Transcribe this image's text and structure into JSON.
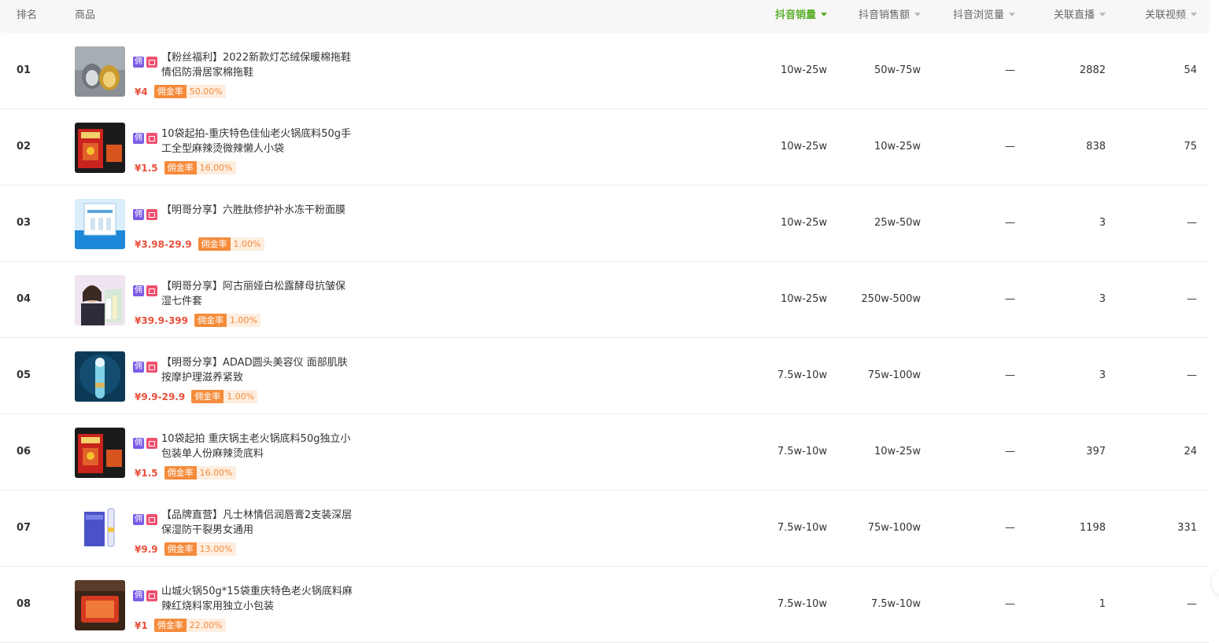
{
  "header": {
    "rank": "排名",
    "product": "商品",
    "sales": "抖音销量",
    "amount": "抖音销售额",
    "views": "抖音浏览量",
    "live": "关联直播",
    "video": "关联视频"
  },
  "labels": {
    "yong": "佣",
    "commission": "佣金率"
  },
  "colors": {
    "accent": "#5bb02c",
    "price": "#e8503a",
    "commission": "#f58b3b"
  },
  "rows": [
    {
      "rank": "01",
      "title": "【粉丝福利】2022新款灯芯绒保暖棉拖鞋情侣防滑居家棉拖鞋",
      "price": "¥4",
      "commission": "50.00%",
      "sales": "10w-25w",
      "amount": "50w-75w",
      "views": "—",
      "live": "2882",
      "video": "54",
      "thumb": "slippers"
    },
    {
      "rank": "02",
      "title": "10袋起拍-重庆特色佳仙老火锅底料50g手工全型麻辣烫微辣懒人小袋",
      "price": "¥1.5",
      "commission": "16.00%",
      "sales": "10w-25w",
      "amount": "10w-25w",
      "views": "—",
      "live": "838",
      "video": "75",
      "thumb": "hotpot"
    },
    {
      "rank": "03",
      "title": "【明哥分享】六胜肽修护补水冻干粉面膜",
      "price": "¥3.98-29.9",
      "commission": "1.00%",
      "sales": "10w-25w",
      "amount": "25w-50w",
      "views": "—",
      "live": "3",
      "video": "—",
      "thumb": "mask"
    },
    {
      "rank": "04",
      "title": "【明哥分享】阿古丽娅白松露酵母抗皱保湿七件套",
      "price": "¥39.9-399",
      "commission": "1.00%",
      "sales": "10w-25w",
      "amount": "250w-500w",
      "views": "—",
      "live": "3",
      "video": "—",
      "thumb": "skincare"
    },
    {
      "rank": "05",
      "title": "【明哥分享】ADAD圆头美容仪 面部肌肤按摩护理滋养紧致",
      "price": "¥9.9-29.9",
      "commission": "1.00%",
      "sales": "7.5w-10w",
      "amount": "75w-100w",
      "views": "—",
      "live": "3",
      "video": "—",
      "thumb": "device"
    },
    {
      "rank": "06",
      "title": "10袋起拍 重庆锅主老火锅底料50g独立小包装单人份麻辣烫底料",
      "price": "¥1.5",
      "commission": "16.00%",
      "sales": "7.5w-10w",
      "amount": "10w-25w",
      "views": "—",
      "live": "397",
      "video": "24",
      "thumb": "hotpot"
    },
    {
      "rank": "07",
      "title": "【品牌直营】凡士林情侣润唇膏2支装深层保湿防干裂男女通用",
      "price": "¥9.9",
      "commission": "13.00%",
      "sales": "7.5w-10w",
      "amount": "75w-100w",
      "views": "—",
      "live": "1198",
      "video": "331",
      "thumb": "lipbalm"
    },
    {
      "rank": "08",
      "title": "山城火锅50g*15袋重庆特色老火锅底料麻辣红烧料家用独立小包装",
      "price": "¥1",
      "commission": "22.00%",
      "sales": "7.5w-10w",
      "amount": "7.5w-10w",
      "views": "—",
      "live": "1",
      "video": "—",
      "thumb": "hotpot2"
    }
  ]
}
